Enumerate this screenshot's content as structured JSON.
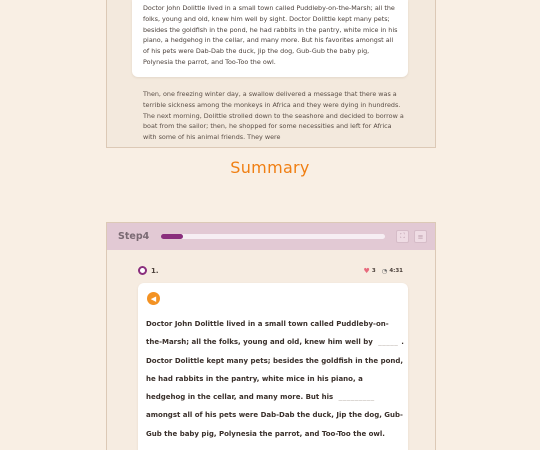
{
  "reading": {
    "paragraph1": "Doctor John Dolittle lived in a small town called Puddleby-on-the-Marsh; all the folks, young and old, knew him well by sight. Doctor Dolittle kept many pets; besides the goldfish in the pond, he had rabbits in the pantry, white mice in his piano, a hedgehog in the cellar, and many more. But his favorites amongst all of his pets were Dab-Dab the duck, Jip the dog, Gub-Gub the baby pig, Polynesia the parrot, and Too-Too the owl.",
    "paragraph2": "Then, one freezing winter day, a swallow delivered a message that there was a terrible sickness among the monkeys in Africa and they were dying in hundreds. The next morning, Dolittle strolled down to the seashore and decided to borrow a boat from the sailor; then, he shopped for some necessities and left for Africa with some of his animal friends. They were"
  },
  "summary_title": "Summary",
  "step": {
    "label": "Step4",
    "progress": 0.1,
    "question_number": "1.",
    "hearts": "3",
    "time": "4:31",
    "text": {
      "part1": "Doctor John Dolittle lived in a small town called Puddleby-on-the-Marsh; all the folks, young and old, knew him well by",
      "blank1": "_____",
      "part2": ". Doctor Dolittle kept many pets; besides the goldfish in the pond, he had rabbits in the pantry, white mice in his piano, a hedgehog in the cellar, and many more. But his",
      "blank2": "_________",
      "part3": "amongst all of his pets were Dab-Dab the duck, Jip the dog, Gub-Gub the baby pig, Polynesia the parrot, and Too-Too the owl."
    }
  },
  "icons": {
    "expand": "expand-icon",
    "menu": "menu-icon",
    "speaker": "speaker-icon",
    "heart": "heart-icon",
    "clock": "clock-icon"
  },
  "colors": {
    "accent_orange": "#f07f13",
    "progress_purple": "#8a2e7d",
    "header_pink": "#e2c9d4"
  }
}
